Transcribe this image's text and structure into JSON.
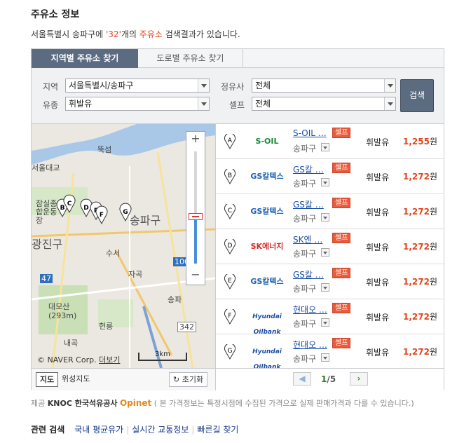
{
  "header": {
    "title": "주유소 정보",
    "summary_prefix": "서울특별시 송파구에 ",
    "summary_count": "'32'",
    "summary_mid": "개의 ",
    "summary_keyword": "주유소",
    "summary_suffix": " 검색결과가 있습니다."
  },
  "tabs": [
    {
      "label": "지역별 주유소 찾기",
      "active": true
    },
    {
      "label": "도로별 주유소 찾기",
      "active": false
    }
  ],
  "search": {
    "region_label": "지역",
    "region_value": "서울특별시/송파구",
    "brand_label": "정유사",
    "brand_value": "전체",
    "fuel_label": "유종",
    "fuel_value": "휘발유",
    "self_label": "셀프",
    "self_value": "전체",
    "search_button": "검색"
  },
  "map": {
    "labels": [
      "뚝섬",
      "서울대교",
      "잠실종합운동장",
      "송파구",
      "광진구",
      "수서",
      "자곡",
      "송파",
      "대모산(293m)",
      "헌릉",
      "내곡",
      "47",
      "100",
      "342"
    ],
    "copyright": "© NAVER Corp.",
    "more_link": "더보기",
    "scale": "3km",
    "btn_map": "지도",
    "btn_satellite": "위성지도",
    "btn_reset": "초기화"
  },
  "stations": [
    {
      "marker": "A",
      "brand": "S-OIL",
      "brand_color": "#1b8a3a",
      "name": "S-OIL …",
      "self": "셀프",
      "district": "송파구",
      "fuel": "휘발유",
      "price": "1,255",
      "unit": "원"
    },
    {
      "marker": "B",
      "brand": "GS칼텍스",
      "brand_color": "#1e63b4",
      "name": "GS칼 …",
      "self": "셀프",
      "district": "송파구",
      "fuel": "휘발유",
      "price": "1,272",
      "unit": "원"
    },
    {
      "marker": "C",
      "brand": "GS칼텍스",
      "brand_color": "#1e63b4",
      "name": "GS칼 …",
      "self": "셀프",
      "district": "송파구",
      "fuel": "휘발유",
      "price": "1,272",
      "unit": "원"
    },
    {
      "marker": "D",
      "brand": "SK에너지",
      "brand_color": "#d62a2a",
      "name": "SK엔 …",
      "self": "셀프",
      "district": "송파구",
      "fuel": "휘발유",
      "price": "1,272",
      "unit": "원"
    },
    {
      "marker": "E",
      "brand": "GS칼텍스",
      "brand_color": "#1e63b4",
      "name": "GS칼 …",
      "self": "셀프",
      "district": "송파구",
      "fuel": "휘발유",
      "price": "1,272",
      "unit": "원"
    },
    {
      "marker": "F",
      "brand": "Hyundai Oilbank",
      "brand_color": "#1f4ea0",
      "name": "현대오 …",
      "self": "셀프",
      "district": "송파구",
      "fuel": "휘발유",
      "price": "1,272",
      "unit": "원"
    },
    {
      "marker": "G",
      "brand": "Hyundai Oilbank",
      "brand_color": "#1f4ea0",
      "name": "현대오 …",
      "self": "셀프",
      "district": "송파구",
      "fuel": "휘발유",
      "price": "1,272",
      "unit": "원"
    }
  ],
  "pager": {
    "current": "1",
    "total": "/5"
  },
  "provider": {
    "label": "제공",
    "knoc": "KNOC 한국석유공사",
    "opinet": "Opinet",
    "note": "( 본 가격정보는 특정시점에 수집된 가격으로 실제 판매가격과 다를 수 있습니다.)"
  },
  "related": {
    "label": "관련 검색",
    "links": [
      "국내 평균유가",
      "실시간 교통정보",
      "빠른길 찾기"
    ]
  }
}
